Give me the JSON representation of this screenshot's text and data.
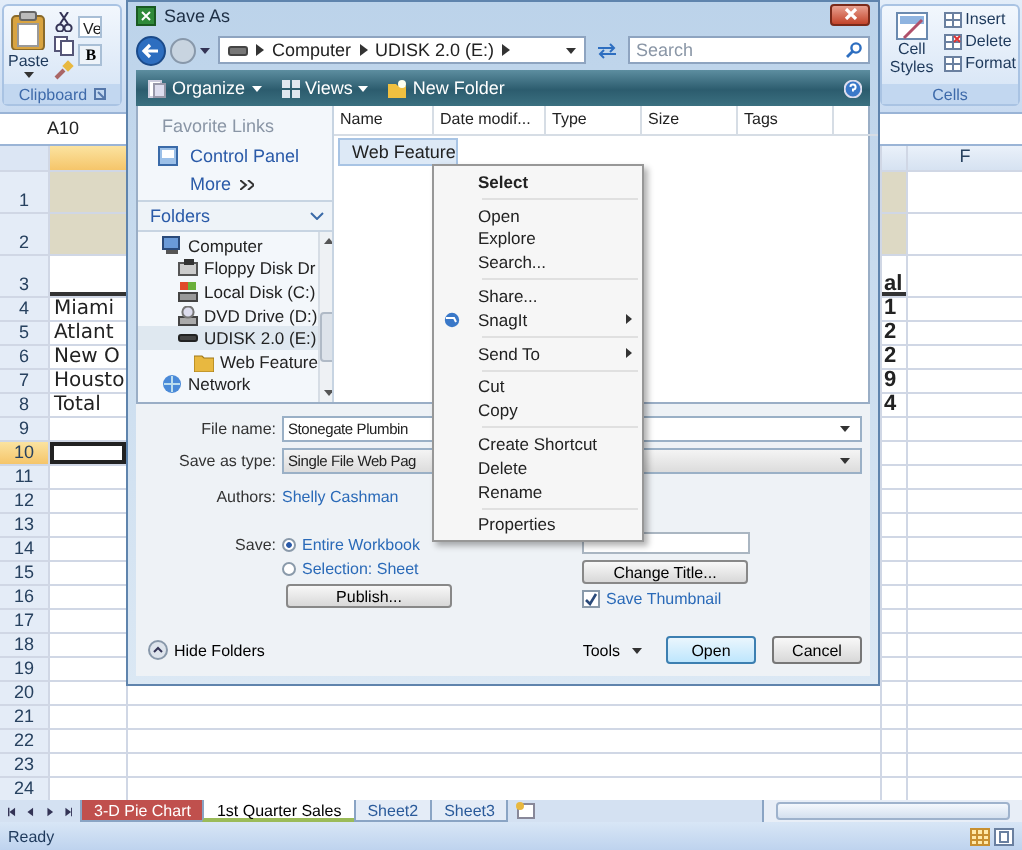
{
  "ribbon": {
    "clipboard": {
      "paste": "Paste",
      "font_box": "Ve",
      "bold_key": "B",
      "label": "Clipboard"
    },
    "cells": {
      "cell_styles": "Cell Styles",
      "actions": [
        "Insert",
        "Delete",
        "Format"
      ],
      "label": "Cells"
    }
  },
  "name_box": "A10",
  "columns": [
    {
      "selected": true
    },
    {
      "selected": false
    },
    {
      "selected": false,
      "label": "F"
    }
  ],
  "rows": [
    {
      "label": "1",
      "kind": "title",
      "selected": false
    },
    {
      "label": "2",
      "kind": "title",
      "selected": false
    },
    {
      "label": "3",
      "kind": "heading",
      "selected": false,
      "cell_e": "al"
    },
    {
      "label": "4",
      "kind": "plain",
      "selected": false,
      "cell_a": "Miami",
      "cell_e": "1"
    },
    {
      "label": "5",
      "kind": "plain",
      "selected": false,
      "cell_a": "Atlant",
      "cell_e": "2"
    },
    {
      "label": "6",
      "kind": "plain",
      "selected": false,
      "cell_a": "New O",
      "cell_e": "2"
    },
    {
      "label": "7",
      "kind": "plain",
      "selected": false,
      "cell_a": "Housto",
      "cell_e": "9"
    },
    {
      "label": "8",
      "kind": "plain",
      "selected": false,
      "cell_a": "Total",
      "cell_e": "4"
    },
    {
      "label": "9",
      "kind": "plain",
      "selected": false
    },
    {
      "label": "10",
      "kind": "plain",
      "selected": true
    },
    {
      "label": "11",
      "kind": "plain",
      "selected": false
    },
    {
      "label": "12",
      "kind": "plain",
      "selected": false
    },
    {
      "label": "13",
      "kind": "plain",
      "selected": false
    },
    {
      "label": "14",
      "kind": "plain",
      "selected": false
    },
    {
      "label": "15",
      "kind": "plain",
      "selected": false
    },
    {
      "label": "16",
      "kind": "plain",
      "selected": false
    },
    {
      "label": "17",
      "kind": "plain",
      "selected": false
    },
    {
      "label": "18",
      "kind": "plain",
      "selected": false
    },
    {
      "label": "19",
      "kind": "plain",
      "selected": false
    },
    {
      "label": "20",
      "kind": "plain",
      "selected": false
    },
    {
      "label": "21",
      "kind": "plain",
      "selected": false
    },
    {
      "label": "22",
      "kind": "plain",
      "selected": false
    },
    {
      "label": "23",
      "kind": "plain",
      "selected": false
    },
    {
      "label": "24",
      "kind": "plain",
      "selected": false
    }
  ],
  "sheet_tabs": [
    {
      "label": "3-D Pie Chart",
      "color": "#c0504d",
      "selected": false
    },
    {
      "label": "1st Quarter Sales",
      "color": "#9bbb59",
      "selected": true
    },
    {
      "label": "Sheet2",
      "selected": false
    },
    {
      "label": "Sheet3",
      "selected": false
    }
  ],
  "status_bar": {
    "text": "Ready"
  },
  "dialog": {
    "title": "Save As",
    "breadcrumbs": [
      "Computer",
      "UDISK 2.0 (E:)"
    ],
    "search": {
      "placeholder": "Search"
    },
    "toolbar": [
      {
        "label": "Organize",
        "kind": "menu"
      },
      {
        "label": "Views",
        "kind": "menu"
      },
      {
        "label": "New Folder",
        "kind": "action"
      }
    ],
    "favorite_links": {
      "title": "Favorite Links",
      "items": [
        "Control Panel"
      ],
      "more": "More"
    },
    "folders": {
      "title": "Folders",
      "tree": [
        {
          "label": "Computer",
          "kind": "computer",
          "selected": false,
          "children": [
            {
              "label": "Floppy Disk Dr",
              "kind": "floppy",
              "selected": false
            },
            {
              "label": "Local Disk (C:)",
              "kind": "disk",
              "selected": false
            },
            {
              "label": "DVD Drive (D:)",
              "kind": "dvd",
              "selected": false
            },
            {
              "label": "UDISK 2.0 (E:)",
              "kind": "usb",
              "selected": true,
              "children": [
                {
                  "label": "Web Feature",
                  "kind": "folder",
                  "selected": false
                }
              ]
            }
          ]
        },
        {
          "label": "Network",
          "kind": "network",
          "selected": false
        }
      ]
    },
    "columns": [
      "Name",
      "Date modif...",
      "Type",
      "Size",
      "Tags"
    ],
    "items": [
      {
        "name": "Web Feature",
        "selected": true
      }
    ],
    "form": {
      "file_name_label": "File name:",
      "file_name": "Stonegate Plumbin",
      "type_label": "Save as type:",
      "type": "Single File Web Pag",
      "authors_label": "Authors:",
      "authors": "Shelly Cashman",
      "save_label": "Save:",
      "save_options": [
        {
          "label": "Entire Workbook",
          "selected": true
        },
        {
          "label": "Selection: Sheet",
          "selected": false
        }
      ],
      "publish": "Publish...",
      "change_title": "Change Title...",
      "thumbnail": {
        "label": "Save Thumbnail",
        "checked": true
      }
    },
    "hide_folders": "Hide Folders",
    "tools": "Tools",
    "buttons": [
      "Open",
      "Cancel"
    ],
    "context_menu": [
      {
        "label": "Select",
        "kind": "default"
      },
      {
        "kind": "separator"
      },
      {
        "label": "Open",
        "kind": "item"
      },
      {
        "label": "Explore",
        "kind": "item"
      },
      {
        "label": "Search...",
        "kind": "item"
      },
      {
        "kind": "separator"
      },
      {
        "label": "Share...",
        "kind": "item"
      },
      {
        "label": "SnagIt",
        "kind": "icon-submenu"
      },
      {
        "kind": "separator"
      },
      {
        "label": "Send To",
        "kind": "submenu"
      },
      {
        "kind": "separator"
      },
      {
        "label": "Cut",
        "kind": "item"
      },
      {
        "label": "Copy",
        "kind": "item"
      },
      {
        "kind": "separator"
      },
      {
        "label": "Create Shortcut",
        "kind": "item"
      },
      {
        "label": "Delete",
        "kind": "item"
      },
      {
        "label": "Rename",
        "kind": "item"
      },
      {
        "kind": "separator"
      },
      {
        "label": "Properties",
        "kind": "item"
      }
    ]
  }
}
